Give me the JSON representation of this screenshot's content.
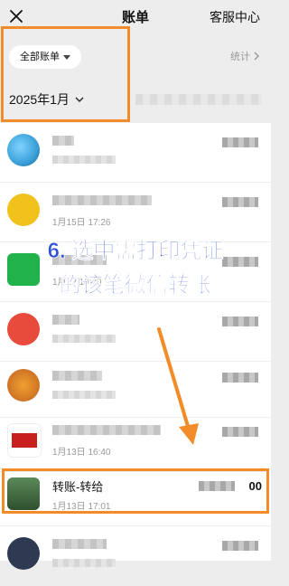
{
  "header": {
    "title": "账单",
    "service_label": "客服中心"
  },
  "filter": {
    "bill_type_label": "全部账单",
    "stats_label": "统计",
    "month_label": "2025年1月"
  },
  "overlay": {
    "line1": "6. 选中需打印凭证",
    "line2": "的该笔微信转账"
  },
  "transactions": [
    {
      "name": "",
      "date": "",
      "amount": "",
      "avatar_color": "#3aa0d8"
    },
    {
      "name": "",
      "date": "1月15日 17:26",
      "amount": "",
      "avatar_color": "#f1c21b"
    },
    {
      "name": "",
      "date": "1月1? 10:30",
      "amount": "",
      "avatar_color": "#22b24c"
    },
    {
      "name": "",
      "date": "",
      "amount": "",
      "avatar_color": "#e84a3c"
    },
    {
      "name": "",
      "date": "",
      "amount": "",
      "avatar_color": "#f0a030"
    },
    {
      "name": "",
      "date": "1月13日 16:40",
      "amount": "",
      "avatar_color": "#c8201e"
    },
    {
      "name": "转账-转给",
      "date": "1月13日 17:01",
      "amount": "00",
      "avatar_color": "#3b6b3a"
    },
    {
      "name": "",
      "date": "",
      "amount": "",
      "avatar_color": "#2d3a52"
    }
  ],
  "colors": {
    "highlight": "#f28c28",
    "overlay_text": "#2c4fd6"
  }
}
